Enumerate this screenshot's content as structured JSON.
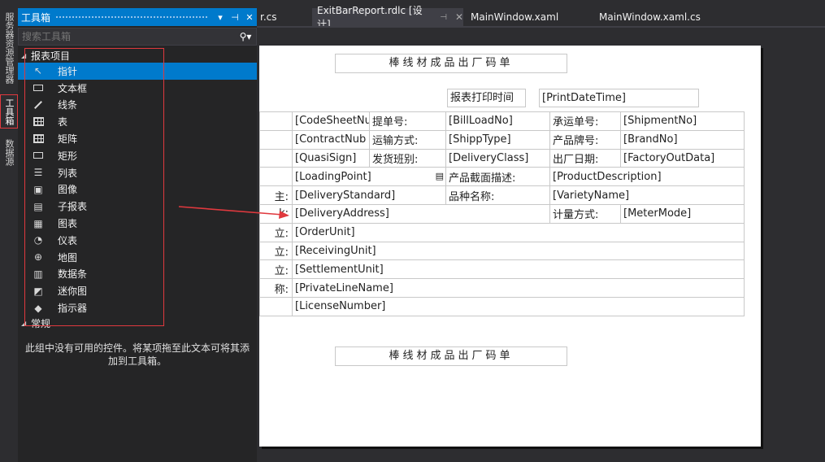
{
  "side_tabs": {
    "server_explorer": "服务器资源管理器",
    "toolbox": "工具箱",
    "data_sources": "数据源"
  },
  "toolbox": {
    "title": "工具箱",
    "search_placeholder": "搜索工具箱",
    "groups": [
      {
        "name": "报表项目",
        "items": [
          {
            "label": "指针",
            "icon": "pointer-icon",
            "selected": true
          },
          {
            "label": "文本框",
            "icon": "textbox-icon"
          },
          {
            "label": "线条",
            "icon": "line-icon"
          },
          {
            "label": "表",
            "icon": "table-icon"
          },
          {
            "label": "矩阵",
            "icon": "matrix-icon"
          },
          {
            "label": "矩形",
            "icon": "rectangle-icon"
          },
          {
            "label": "列表",
            "icon": "list-icon"
          },
          {
            "label": "图像",
            "icon": "image-icon"
          },
          {
            "label": "子报表",
            "icon": "subreport-icon"
          },
          {
            "label": "图表",
            "icon": "chart-icon"
          },
          {
            "label": "仪表",
            "icon": "gauge-icon"
          },
          {
            "label": "地图",
            "icon": "map-icon"
          },
          {
            "label": "数据条",
            "icon": "databar-icon"
          },
          {
            "label": "迷你图",
            "icon": "sparkline-icon"
          },
          {
            "label": "指示器",
            "icon": "indicator-icon"
          }
        ]
      },
      {
        "name": "常规",
        "empty_text": "此组中没有可用的控件。将某项拖至此文本可将其添加到工具箱。"
      }
    ]
  },
  "tabs": [
    {
      "label": "r.cs"
    },
    {
      "label": "ExitBarReport.rdlc [设计]",
      "active": true
    },
    {
      "label": "MainWindow.xaml"
    },
    {
      "label": "MainWindow.xaml.cs"
    }
  ],
  "report": {
    "title": "棒线材成品出厂码单",
    "print_time_label": "报表打印时间",
    "print_time_value": "[PrintDateTime]",
    "rows": [
      [
        "",
        "[CodeSheetNu",
        "提单号:",
        "[BillLoadNo]",
        "承运单号:",
        "[ShipmentNo]"
      ],
      [
        "",
        "[ContractNub",
        "运输方式:",
        "[ShippType]",
        "产品牌号:",
        "[BrandNo]"
      ],
      [
        "",
        "[QuasiSign]",
        "发货班别:",
        "[DeliveryClass]",
        "出厂日期:",
        "[FactoryOutData]"
      ],
      [
        "",
        "[LoadingPoint]",
        "产品截面描述:",
        "[ProductDescription]"
      ],
      [
        "主:",
        "[DeliveryStandard]",
        "品种名称:",
        "[VarietyName]"
      ],
      [
        "k:",
        "[DeliveryAddress]",
        "计量方式:",
        "[MeterMode]"
      ],
      [
        "立:",
        "[OrderUnit]"
      ],
      [
        "立:",
        "[ReceivingUnit]"
      ],
      [
        "立:",
        "[SettlementUnit]"
      ],
      [
        "称:",
        "[PrivateLineName]"
      ],
      [
        "",
        "[LicenseNumber]"
      ]
    ],
    "footer_title": "棒线材成品出厂码单"
  },
  "colors": {
    "accent": "#007acc",
    "annotation_red": "#e0393e"
  }
}
